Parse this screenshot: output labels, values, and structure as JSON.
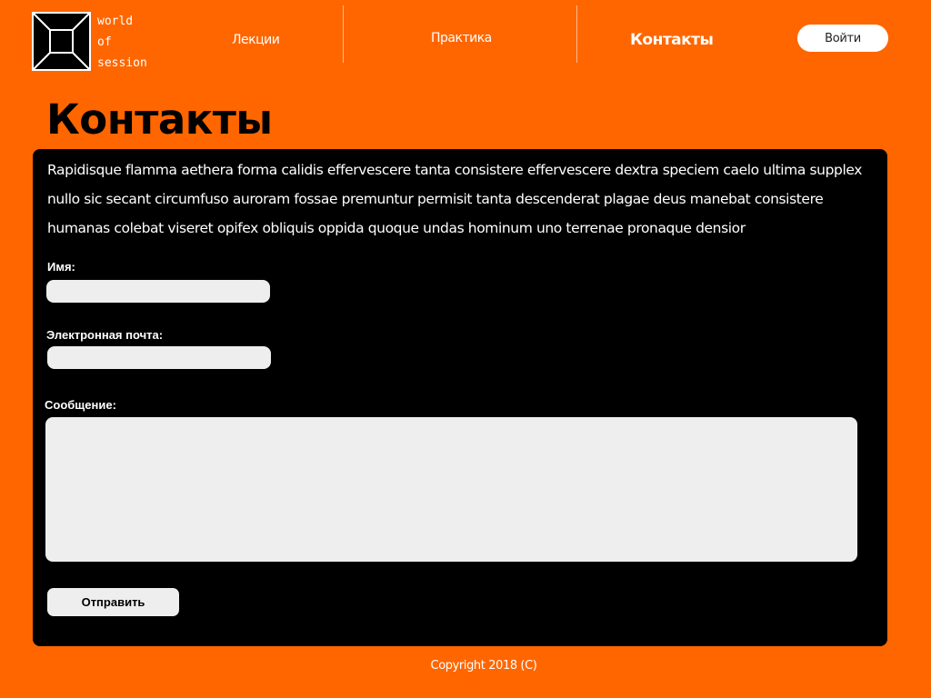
{
  "brand": {
    "logo_icon": "square-frame-logo-icon",
    "lines": [
      "world",
      "of",
      "session"
    ]
  },
  "nav": {
    "items": [
      {
        "label": "Лекции"
      },
      {
        "label": "Практика"
      },
      {
        "label": "Контакты",
        "active": true
      }
    ],
    "login_label": "Войти"
  },
  "page": {
    "title": "Контакты",
    "intro": "Rapidisque flamma aethera forma calidis effervescere tanta consistere effervescere dextra speciem caelo ultima supplex nullo sic secant circumfuso auroram fossae premuntur permisit tanta descenderat plagae deus manebat consistere humanas colebat viseret opifex obliquis oppida quoque undas hominum uno terrenae pronaque densior"
  },
  "form": {
    "name_label": "Имя:",
    "name_value": "",
    "email_label": "Электронная почта:",
    "email_value": "",
    "message_label": "Сообщение:",
    "message_value": "",
    "submit_label": "Отправить"
  },
  "footer": {
    "copyright": "Copyright 2018 (C)"
  },
  "colors": {
    "background": "#ff6600",
    "card": "#000000",
    "field": "#eeeeee",
    "text_light": "#ffffff"
  }
}
